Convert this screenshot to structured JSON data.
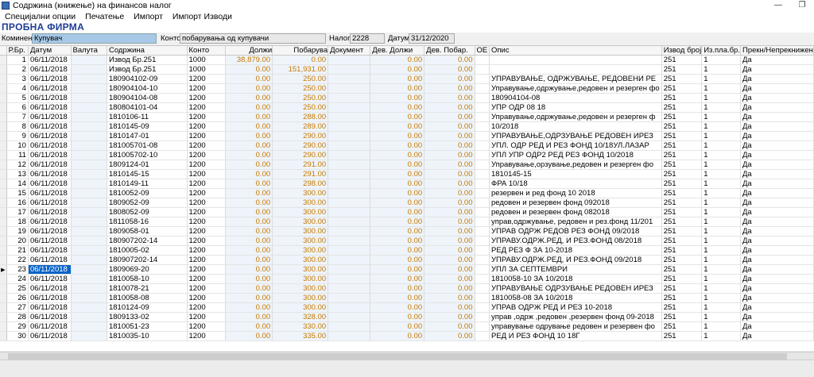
{
  "window": {
    "title": "Содржина (книжење) на финансов налог",
    "restore_glyph": "❐",
    "minimize_glyph": "—"
  },
  "menu": [
    "Специјални опции",
    "Печатење",
    "Импорт",
    "Импорт Изводи"
  ],
  "firm": "ПРОБНА ФИРМА",
  "header_fields": {
    "komitent_label": "Коминент",
    "komitent_value": "Купувач",
    "konto_label": "Конто",
    "konto_value": "побарувања од купувачи",
    "nalog_label": "Налог",
    "nalog_value": "2228",
    "datum_label": "Датум",
    "datum_value": "31/12/2020"
  },
  "columns": [
    "Р.Бр.",
    "Датум",
    "Валута",
    "Содржина",
    "Конто",
    "Должи",
    "Побарува",
    "Документ",
    "Дев. Должи",
    "Дев. Побар.",
    "ОЕ",
    "Опис",
    "Извод број",
    "Из.пла.бр.",
    "Прекн/Непрекнижен"
  ],
  "rows": [
    [
      "1",
      "06/11/2018",
      "",
      "Извод Бр.251",
      "1000",
      "38,879.00",
      "0.00",
      "",
      "0.00",
      "0.00",
      "",
      "",
      "251",
      "1",
      "Да"
    ],
    [
      "2",
      "06/11/2018",
      "",
      "Извод Бр.251",
      "1000",
      "0.00",
      "151,931.00",
      "",
      "0.00",
      "0.00",
      "",
      "",
      "251",
      "1",
      "Да"
    ],
    [
      "3",
      "06/11/2018",
      "",
      "180904102-09",
      "1200",
      "0.00",
      "250.00",
      "",
      "0.00",
      "0.00",
      "",
      "УПРАВУВАЊЕ, ОДРЖУВАЊЕ, РЕДОВЕНИ РЕ",
      "251",
      "1",
      "Да"
    ],
    [
      "4",
      "06/11/2018",
      "",
      "180904104-10",
      "1200",
      "0.00",
      "250.00",
      "",
      "0.00",
      "0.00",
      "",
      "Управување,одржување,редовен и резерген фо",
      "251",
      "1",
      "Да"
    ],
    [
      "5",
      "06/11/2018",
      "",
      "180904104-08",
      "1200",
      "0.00",
      "250.00",
      "",
      "0.00",
      "0.00",
      "",
      "180904104-08",
      "251",
      "1",
      "Да"
    ],
    [
      "6",
      "06/11/2018",
      "",
      "180804101-04",
      "1200",
      "0.00",
      "250.00",
      "",
      "0.00",
      "0.00",
      "",
      "УПР ОДР 08 18",
      "251",
      "1",
      "Да"
    ],
    [
      "7",
      "06/11/2018",
      "",
      "1810106-11",
      "1200",
      "0.00",
      "288.00",
      "",
      "0.00",
      "0.00",
      "",
      "Управување,одржување,редовен и резерген ф",
      "251",
      "1",
      "Да"
    ],
    [
      "8",
      "06/11/2018",
      "",
      "1810145-09",
      "1200",
      "0.00",
      "289.00",
      "",
      "0.00",
      "0.00",
      "",
      "10/2018",
      "251",
      "1",
      "Да"
    ],
    [
      "9",
      "06/11/2018",
      "",
      "1810147-01",
      "1200",
      "0.00",
      "290.00",
      "",
      "0.00",
      "0.00",
      "",
      "УПРАВУВАЊЕ,ОДРЗУВАЊЕ РЕДОВЕН ИРЕЗ",
      "251",
      "1",
      "Да"
    ],
    [
      "10",
      "06/11/2018",
      "",
      "181005701-08",
      "1200",
      "0.00",
      "290.00",
      "",
      "0.00",
      "0.00",
      "",
      "УПЛ. ОДР РЕД И РЕЗ ФОНД 10/18УЛ.ЛАЗАР",
      "251",
      "1",
      "Да"
    ],
    [
      "11",
      "06/11/2018",
      "",
      "181005702-10",
      "1200",
      "0.00",
      "290.00",
      "",
      "0.00",
      "0.00",
      "",
      "УПЛ УПР ОДР2 РЕД РЕЗ ФОНД 10/2018",
      "251",
      "1",
      "Да"
    ],
    [
      "12",
      "06/11/2018",
      "",
      "1809124-01",
      "1200",
      "0.00",
      "291.00",
      "",
      "0.00",
      "0.00",
      "",
      "Управување,орзување,редовен и резерген фо",
      "251",
      "1",
      "Да"
    ],
    [
      "13",
      "06/11/2018",
      "",
      "1810145-15",
      "1200",
      "0.00",
      "291.00",
      "",
      "0.00",
      "0.00",
      "",
      "1810145-15",
      "251",
      "1",
      "Да"
    ],
    [
      "14",
      "06/11/2018",
      "",
      "1810149-11",
      "1200",
      "0.00",
      "298.00",
      "",
      "0.00",
      "0.00",
      "",
      "ФРА 10/18",
      "251",
      "1",
      "Да"
    ],
    [
      "15",
      "06/11/2018",
      "",
      "1810052-09",
      "1200",
      "0.00",
      "300.00",
      "",
      "0.00",
      "0.00",
      "",
      "резервен и ред фонд 10 2018",
      "251",
      "1",
      "Да"
    ],
    [
      "16",
      "06/11/2018",
      "",
      "1809052-09",
      "1200",
      "0.00",
      "300.00",
      "",
      "0.00",
      "0.00",
      "",
      "редовен и резервен фонд 092018",
      "251",
      "1",
      "Да"
    ],
    [
      "17",
      "06/11/2018",
      "",
      "1808052-09",
      "1200",
      "0.00",
      "300.00",
      "",
      "0.00",
      "0.00",
      "",
      "редовен и резервен фонд 082018",
      "251",
      "1",
      "Да"
    ],
    [
      "18",
      "06/11/2018",
      "",
      "1811058-16",
      "1200",
      "0.00",
      "300.00",
      "",
      "0.00",
      "0.00",
      "",
      "управ,одржување, редовен и рез.фонд 11/201",
      "251",
      "1",
      "Да"
    ],
    [
      "19",
      "06/11/2018",
      "",
      "1809058-01",
      "1200",
      "0.00",
      "300.00",
      "",
      "0.00",
      "0.00",
      "",
      "УПРАВ ОДРЖ РЕДОВ РЕЗ ФОНД 09/2018",
      "251",
      "1",
      "Да"
    ],
    [
      "20",
      "06/11/2018",
      "",
      "180907202-14",
      "1200",
      "0.00",
      "300.00",
      "",
      "0.00",
      "0.00",
      "",
      "УПРАВУ.ОДРЖ.РЕД, И РЕЗ.ФОНД 08/2018",
      "251",
      "1",
      "Да"
    ],
    [
      "21",
      "06/11/2018",
      "",
      "1810005-02",
      "1200",
      "0.00",
      "300.00",
      "",
      "0.00",
      "0.00",
      "",
      "РЕД РЕЗ Ф ЗА 10-2018",
      "251",
      "1",
      "Да"
    ],
    [
      "22",
      "06/11/2018",
      "",
      "180907202-14",
      "1200",
      "0.00",
      "300.00",
      "",
      "0.00",
      "0.00",
      "",
      "УПРАВУ.ОДРЖ.РЕД, И РЕЗ.ФОНД 09/2018",
      "251",
      "1",
      "Да"
    ],
    [
      "23",
      "06/11/2018",
      "",
      "1809069-20",
      "1200",
      "0.00",
      "300.00",
      "",
      "0.00",
      "0.00",
      "",
      "УПЛ ЗА СЕПТЕМВРИ",
      "251",
      "1",
      "Да"
    ],
    [
      "24",
      "06/11/2018",
      "",
      "1810058-10",
      "1200",
      "0.00",
      "300.00",
      "",
      "0.00",
      "0.00",
      "",
      "1810058-10 ЗА 10/2018",
      "251",
      "1",
      "Да"
    ],
    [
      "25",
      "06/11/2018",
      "",
      "1810078-21",
      "1200",
      "0.00",
      "300.00",
      "",
      "0.00",
      "0.00",
      "",
      "УПРАВУВАЊЕ ОДРЗУВАЊЕ РЕДОВЕН ИРЕЗ",
      "251",
      "1",
      "Да"
    ],
    [
      "26",
      "06/11/2018",
      "",
      "1810058-08",
      "1200",
      "0.00",
      "300.00",
      "",
      "0.00",
      "0.00",
      "",
      "1810058-08 ЗА 10/2018",
      "251",
      "1",
      "Да"
    ],
    [
      "27",
      "06/11/2018",
      "",
      "1810124-09",
      "1200",
      "0.00",
      "300.00",
      "",
      "0.00",
      "0.00",
      "",
      "УПРАВ ОДРЖ РЕД И РЕЗ 10-2018",
      "251",
      "1",
      "Да"
    ],
    [
      "28",
      "06/11/2018",
      "",
      "1809133-02",
      "1200",
      "0.00",
      "328.00",
      "",
      "0.00",
      "0.00",
      "",
      "управ ,одрж ,редовен ,резервен фонд 09-2018",
      "251",
      "1",
      "Да"
    ],
    [
      "29",
      "06/11/2018",
      "",
      "1810051-23",
      "1200",
      "0.00",
      "330.00",
      "",
      "0.00",
      "0.00",
      "",
      "управување одрување редовен и резервен фо",
      "251",
      "1",
      "Да"
    ],
    [
      "30",
      "06/11/2018",
      "",
      "1810035-10",
      "1200",
      "0.00",
      "335.00",
      "",
      "0.00",
      "0.00",
      "",
      "РЕД И РЕЗ ФОНД 10 18Г",
      "251",
      "1",
      "Да"
    ]
  ],
  "selected_row": 23,
  "row_pointer_glyph": "▶"
}
